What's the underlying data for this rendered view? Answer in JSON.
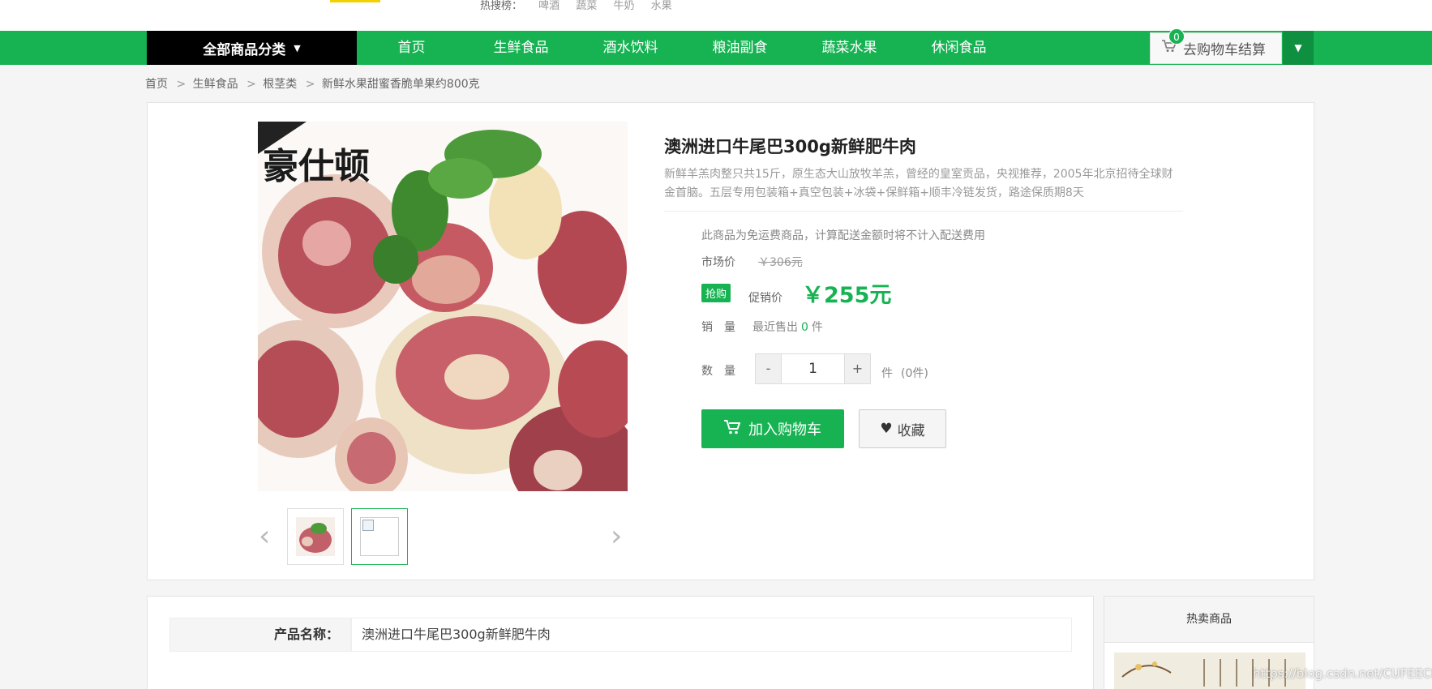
{
  "header": {
    "hot_search_label": "热搜榜：",
    "hot_keywords": [
      "啤酒",
      "蔬菜",
      "牛奶",
      "水果"
    ]
  },
  "nav": {
    "all_categories": "全部商品分类",
    "links": [
      "首页",
      "生鲜食品",
      "酒水饮料",
      "粮油副食",
      "蔬菜水果",
      "休闲食品"
    ],
    "cart_label": "去购物车结算",
    "cart_count": "0"
  },
  "breadcrumb": [
    "首页",
    "生鲜食品",
    "根茎类",
    "新鲜水果甜蜜香脆单果约800克"
  ],
  "product": {
    "image_text": "豪仕顿",
    "title": "澳洲进口牛尾巴300g新鲜肥牛肉",
    "description": "新鲜羊羔肉整只共15斤，原生态大山放牧羊羔，曾经的皇室贡品，央视推荐，2005年北京招待全球财金首脑。五层专用包装箱+真空包装+冰袋+保鲜箱+顺丰冷链发货，路途保质期8天",
    "free_shipping_note": "此商品为免运费商品，计算配送金额时将不计入配送费用",
    "market_price_label": "市场价",
    "market_price": "￥306元",
    "badge": "抢购",
    "sale_price_label": "促销价",
    "sale_price": "￥255元",
    "sales_label": "销　量",
    "sales_prefix": "最近售出",
    "sales_count": "0",
    "sales_unit": "件",
    "quantity_label": "数　量",
    "quantity_minus": "-",
    "quantity_value": "1",
    "quantity_plus": "+",
    "quantity_unit": "件",
    "stock_note": "(0件)",
    "add_to_cart": "加入购物车",
    "favorite": "收藏"
  },
  "specs": {
    "name_label": "产品名称：",
    "name_value": "澳洲进口牛尾巴300g新鲜肥牛肉"
  },
  "sidebar": {
    "hot_title": "热卖商品"
  },
  "watermark": "https://blog.csdn.net/CUFEECR",
  "colors": {
    "brand_green": "#17b353",
    "nav_black": "#000000"
  }
}
